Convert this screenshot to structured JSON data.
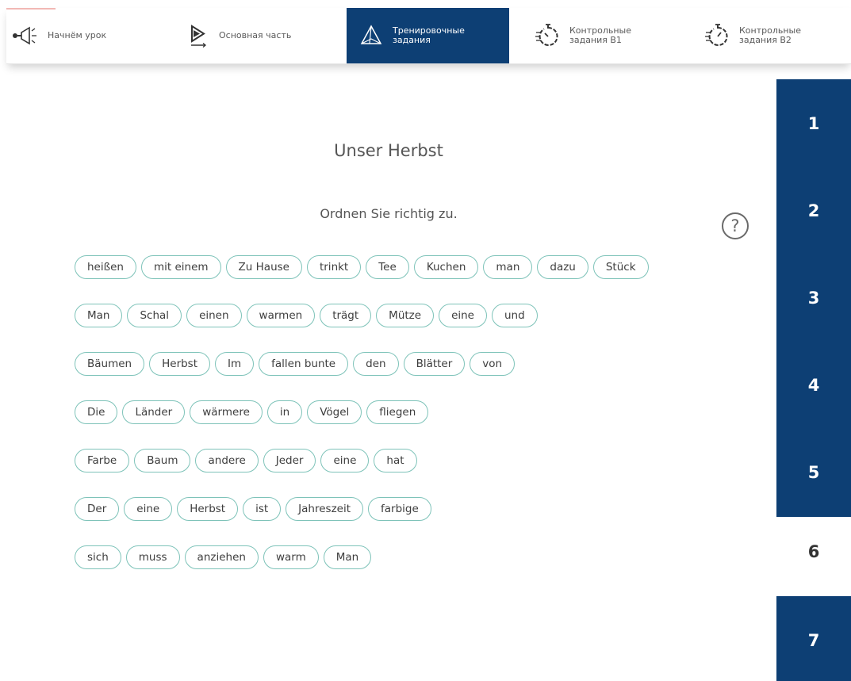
{
  "nav": {
    "items": [
      {
        "label": "Начнём урок",
        "icon": "megaphone-icon",
        "active": false
      },
      {
        "label": "Основная часть",
        "icon": "play-icon",
        "active": false
      },
      {
        "label": "Тренировочные\nзадания",
        "icon": "pyramid-icon",
        "active": true
      },
      {
        "label": "Контрольные\nзадания В1",
        "icon": "stopwatch-icon",
        "active": false
      },
      {
        "label": "Контрольные\nзадания В2",
        "icon": "stopwatch-icon",
        "active": false
      }
    ]
  },
  "task": {
    "title": "Unser Herbst",
    "instruction": "Ordnen Sie richtig zu.",
    "help_symbol": "?"
  },
  "rows": [
    [
      "heißen",
      "mit einem",
      "Zu Hause",
      "trinkt",
      "Tee",
      "Kuchen",
      "man",
      "dazu",
      "Stück"
    ],
    [
      "Man",
      "Schal",
      "einen",
      "warmen",
      "trägt",
      "Mütze",
      "eine",
      "und"
    ],
    [
      "Bäumen",
      "Herbst",
      "Im",
      "fallen bunte",
      "den",
      "Blätter",
      "von"
    ],
    [
      "Die",
      "Länder",
      "wärmere",
      "in",
      "Vögel",
      "fliegen"
    ],
    [
      "Farbe",
      "Baum",
      "andere",
      "Jeder",
      "eine",
      "hat"
    ],
    [
      "Der",
      "eine",
      "Herbst",
      "ist",
      "Jahreszeit",
      "farbige"
    ],
    [
      "sich",
      "muss",
      "anziehen",
      "warm",
      "Man"
    ]
  ],
  "task_numbers": [
    "1",
    "2",
    "3",
    "4",
    "5",
    "6",
    "7"
  ],
  "current_task": "6",
  "colors": {
    "primary": "#0d3f74",
    "chip_border": "#7ec3b9",
    "text": "#555555"
  }
}
